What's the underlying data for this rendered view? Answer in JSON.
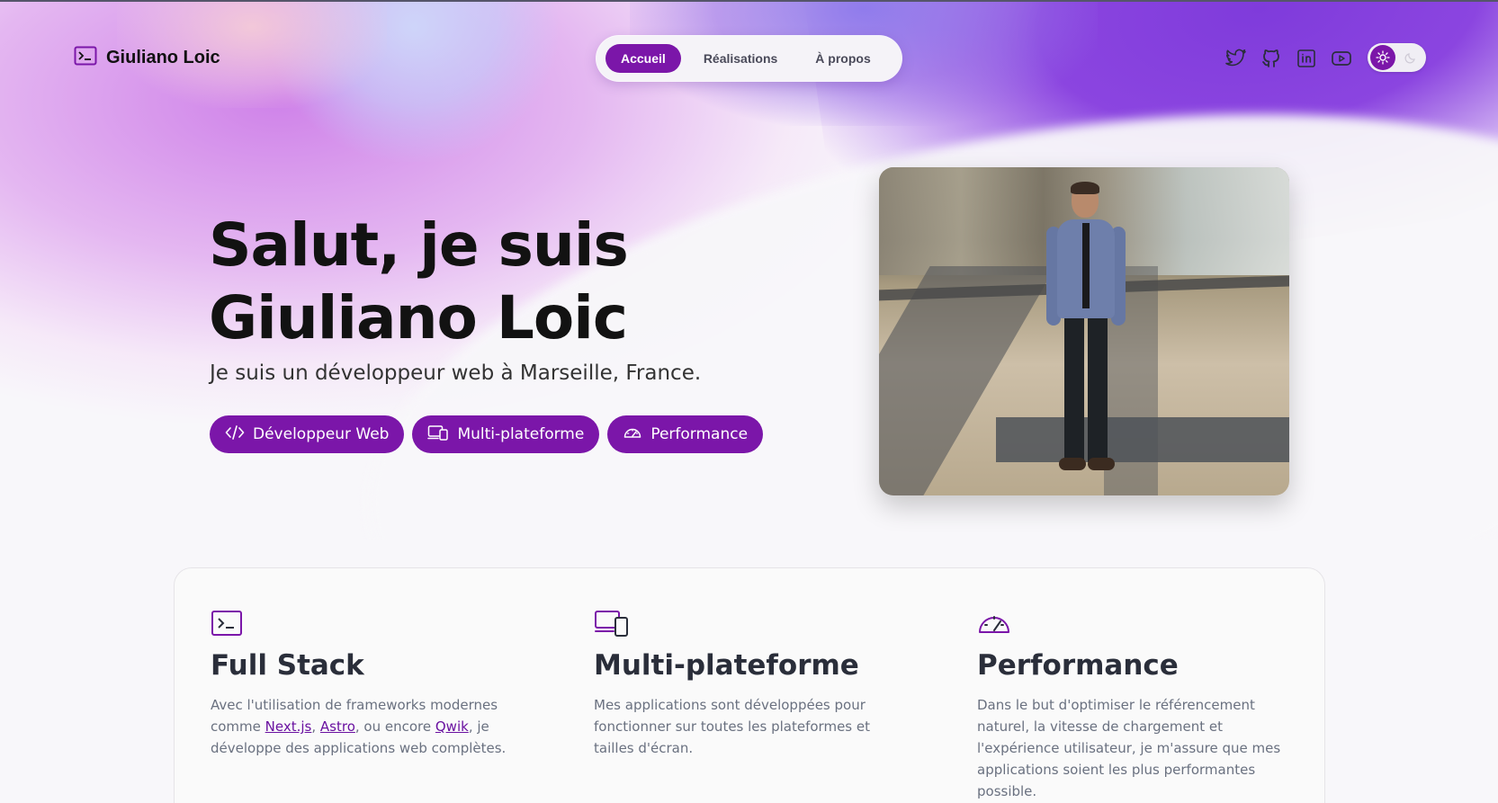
{
  "header": {
    "logo_text": "Giuliano Loic",
    "nav": [
      {
        "label": "Accueil",
        "active": true
      },
      {
        "label": "Réalisations",
        "active": false
      },
      {
        "label": "À propos",
        "active": false
      }
    ],
    "socials": [
      "twitter-icon",
      "github-icon",
      "linkedin-icon",
      "youtube-icon"
    ],
    "theme_toggle": {
      "active": "light",
      "icons": [
        "sun-icon",
        "moon-icon"
      ]
    }
  },
  "hero": {
    "title_line1": "Salut, je suis",
    "title_line2": "Giuliano Loic",
    "subtitle": "Je suis un développeur web à Marseille, France.",
    "badges": [
      {
        "label": "Développeur Web",
        "icon": "code-icon"
      },
      {
        "label": "Multi-plateforme",
        "icon": "devices-icon"
      },
      {
        "label": "Performance",
        "icon": "gauge-icon"
      }
    ],
    "image": "3d-avatar-portrait"
  },
  "features": [
    {
      "icon": "terminal-icon",
      "title": "Full Stack",
      "text_pre": "Avec l'utilisation de frameworks modernes comme ",
      "link1": "Next.js",
      "sep1": ", ",
      "link2": "Astro",
      "sep2": ", ou encore ",
      "link3": "Qwik",
      "text_post": ", je développe des applications web complètes."
    },
    {
      "icon": "devices-icon",
      "title": "Multi-plateforme",
      "text": "Mes applications sont développées pour fonctionner sur toutes les plateformes et tailles d'écran."
    },
    {
      "icon": "gauge-icon",
      "title": "Performance",
      "text": "Dans le but d'optimiser le référencement naturel, la vitesse de chargement et l'expérience utilisateur, je m'assure que mes applications soient les plus performantes possible."
    }
  ],
  "colors": {
    "accent": "#7b16a9",
    "text": "#121212",
    "muted": "#6a7180"
  }
}
